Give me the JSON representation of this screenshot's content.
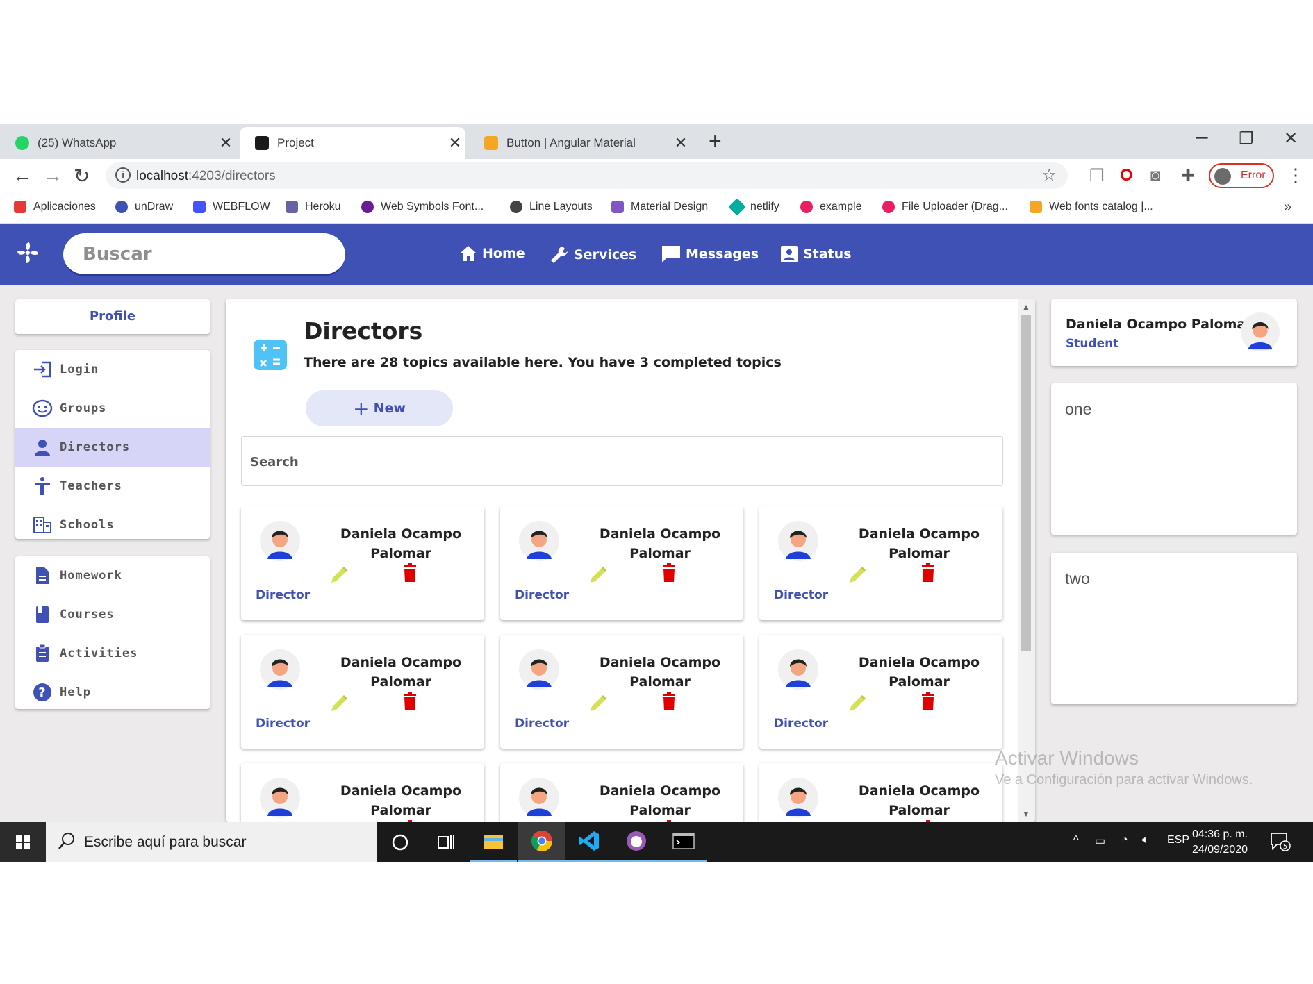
{
  "browser": {
    "tabs": [
      {
        "title": "(25) WhatsApp",
        "badge": "25"
      },
      {
        "title": "Project"
      },
      {
        "title": "Button | Angular Material"
      }
    ],
    "url_host": "localhost",
    "url_rest": ":4203/directors",
    "profile_status": "Error",
    "bookmarks": [
      "Aplicaciones",
      "unDraw",
      "WEBFLOW",
      "Heroku",
      "Web Symbols Font...",
      "Line Layouts",
      "Material Design",
      "netlify",
      "example",
      "File Uploader (Drag...",
      "Web fonts catalog |..."
    ],
    "bookmark_colors": [
      "#e53935",
      "#3f51b5",
      "#4353ff",
      "#6762a6",
      "#6a1b9a",
      "#444444",
      "#7e57c2",
      "#00ad9f",
      "#e91e63",
      "#e91e63",
      "#f5a623"
    ]
  },
  "header": {
    "search_placeholder": "Buscar",
    "nav": [
      "Home",
      "Services",
      "Messages",
      "Status"
    ]
  },
  "sidebar": {
    "profile_label": "Profile",
    "group1": [
      "Login",
      "Groups",
      "Directors",
      "Teachers",
      "Schools"
    ],
    "selected": "Directors",
    "group2": [
      "Homework",
      "Courses",
      "Activities",
      "Help"
    ]
  },
  "main": {
    "title": "Directors",
    "subtitle": "There are 28 topics available here. You have 3 completed topics",
    "new_label": "New",
    "search_placeholder": "Search",
    "cards": [
      {
        "name": "Daniela Ocampo Palomar",
        "role": "Director"
      },
      {
        "name": "Daniela Ocampo Palomar",
        "role": "Director"
      },
      {
        "name": "Daniela Ocampo Palomar",
        "role": "Director"
      },
      {
        "name": "Daniela Ocampo Palomar",
        "role": "Director"
      },
      {
        "name": "Daniela Ocampo Palomar",
        "role": "Director"
      },
      {
        "name": "Daniela Ocampo Palomar",
        "role": "Director"
      },
      {
        "name": "Daniela Ocampo Palomar",
        "role": ""
      },
      {
        "name": "Daniela Ocampo Palomar",
        "role": ""
      },
      {
        "name": "Daniela Ocampo Palomar",
        "role": ""
      }
    ]
  },
  "user": {
    "name": "Daniela Ocampo Palomar",
    "role": "Student"
  },
  "right_boxes": [
    "one",
    "two"
  ],
  "watermark": {
    "line1": "Activar Windows",
    "line2": "Ve a Configuración para activar Windows."
  },
  "taskbar": {
    "search_placeholder": "Escribe aquí para buscar",
    "lang": "ESP",
    "time": "04:36 p. m.",
    "date": "24/09/2020",
    "notifications": "5"
  },
  "colors": {
    "primary": "#3f51b5",
    "selected_bg": "#d6d4f7",
    "delete": "#e00000",
    "edit": "#d4e157"
  }
}
